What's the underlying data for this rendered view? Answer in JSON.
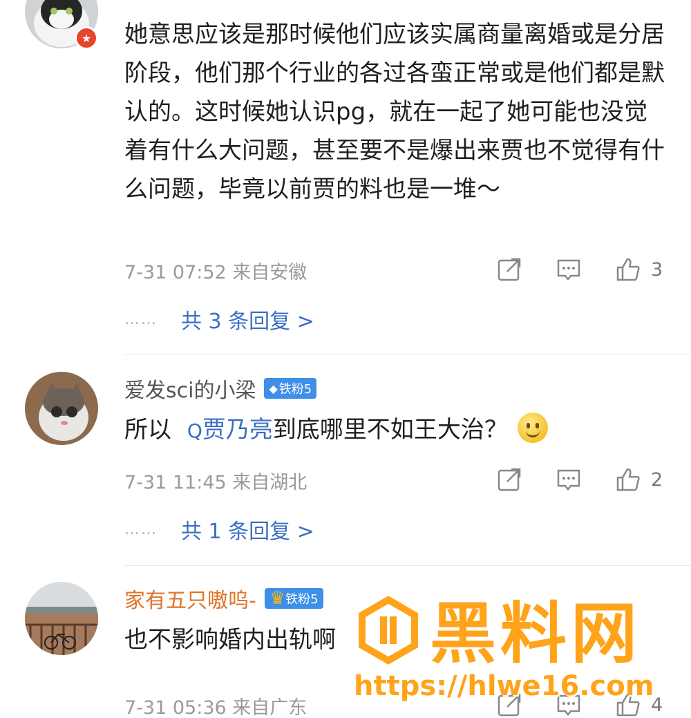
{
  "comments": [
    {
      "username": "",
      "text": "她意思应该是那时候他们应该实属商量离婚或是分居阶段，他们那个行业的各过各蛮正常或是他们都是默认的。这时候她认识pg，就在一起了她可能也没觉着有什么大问题，甚至要不是爆出来贾也不觉得有什么问题，毕竟以前贾的料也是一堆～",
      "meta": "7-31 07:52 来自安徽",
      "likes": "3",
      "replies": "共 3 条回复 >"
    },
    {
      "username": "爱发sci的小梁",
      "badge": "铁粉5",
      "text_before": "所以",
      "mention": "贾乃亮",
      "text_after": "到底哪里不如王大治？",
      "meta": "7-31 11:45 来自湖北",
      "likes": "2",
      "replies": "共 1 条回复 >"
    },
    {
      "username": "家有五只嗷呜-",
      "badge": "铁粉5",
      "text": "也不影响婚内出轨啊",
      "meta": "7-31 05:36 来自广东",
      "likes": "4"
    }
  ],
  "ui": {
    "dots": "……",
    "search_glyph": "Q"
  },
  "watermark": {
    "title": "黑料网",
    "url": "https://hlwe16.com"
  },
  "icons": [
    "share-icon",
    "comment-icon",
    "like-icon",
    "vip-star-icon",
    "diamond-icon",
    "crown-icon"
  ],
  "colors": {
    "link": "#3a6fc4",
    "badge": "#3e8fe8",
    "vip": "#e8432d",
    "watermark": "#ffa31a",
    "username_orange": "#e0742a"
  }
}
